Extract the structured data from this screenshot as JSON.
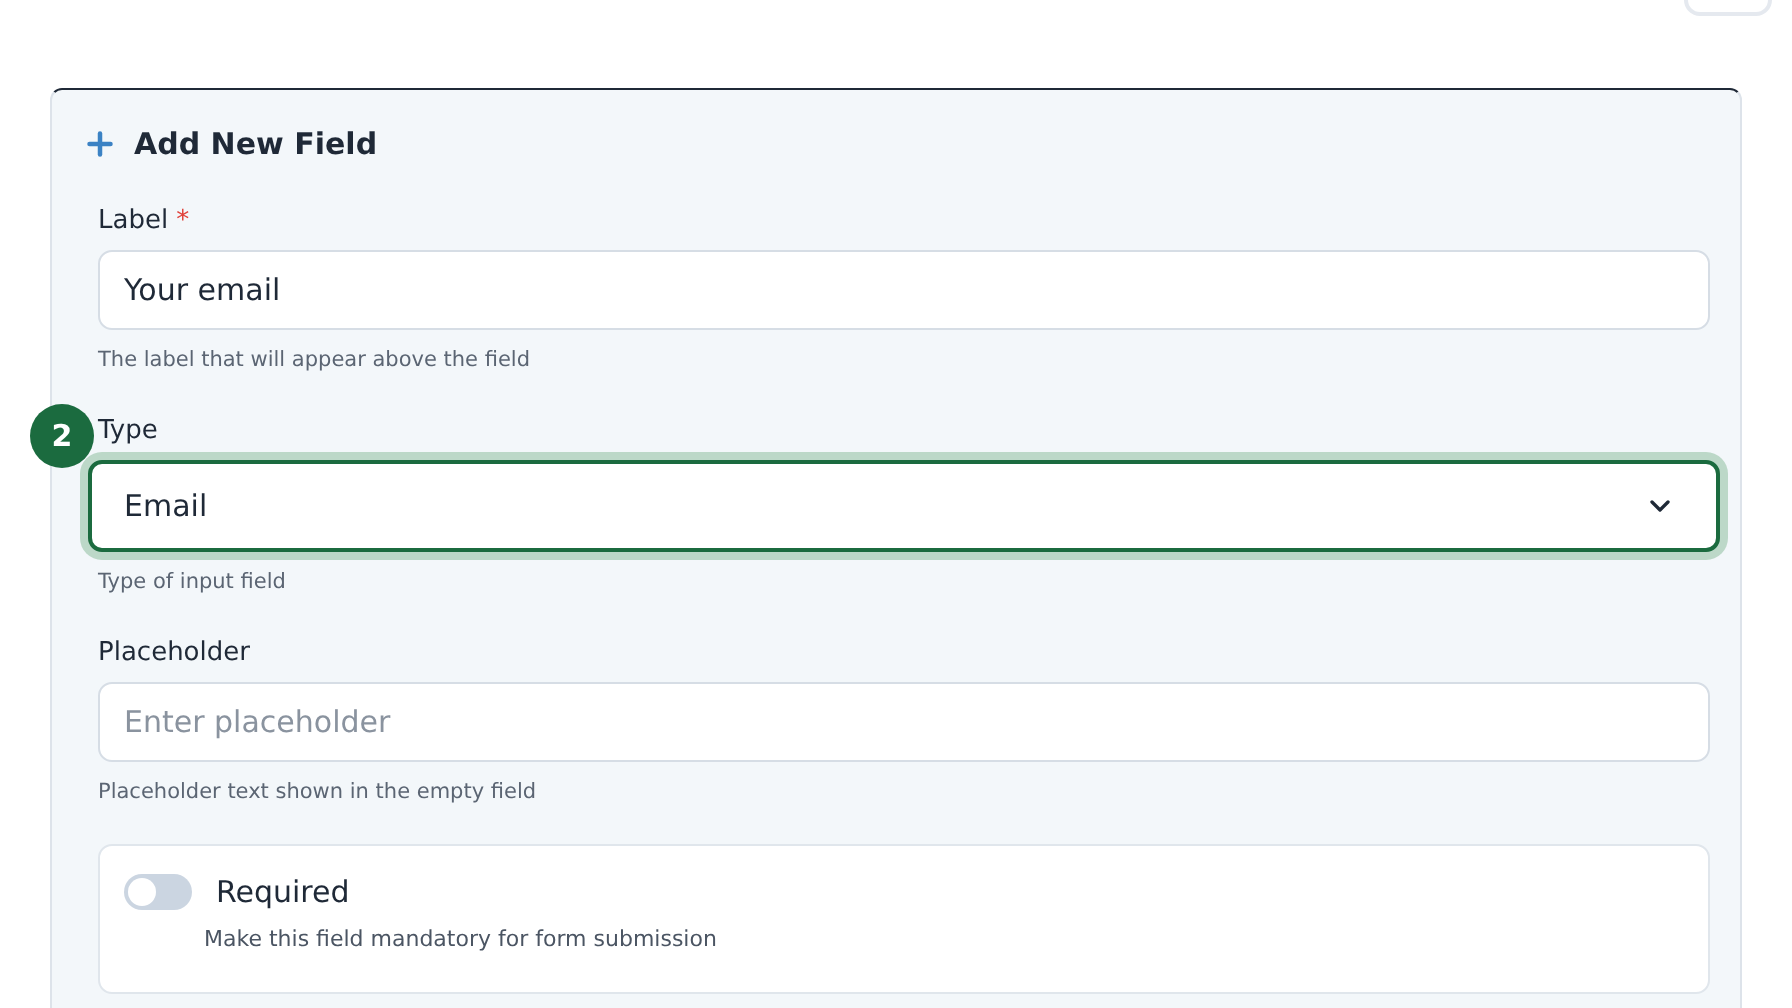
{
  "card": {
    "title": "Add New Field"
  },
  "fields": [
    {
      "kind": "text",
      "label": "Label",
      "required_mark": "*",
      "value": "Your email",
      "help": "The label that will appear above the field",
      "focused": false
    },
    {
      "kind": "select",
      "label": "Type",
      "value": "Email",
      "help": "Type of input field",
      "focused": true,
      "step_badge": "2"
    },
    {
      "kind": "text",
      "label": "Placeholder",
      "placeholder": "Enter placeholder",
      "help": "Placeholder text shown in the empty field",
      "focused": false
    }
  ],
  "required_toggle": {
    "label": "Required",
    "description": "Make this field mandatory for form submission",
    "on": false
  }
}
